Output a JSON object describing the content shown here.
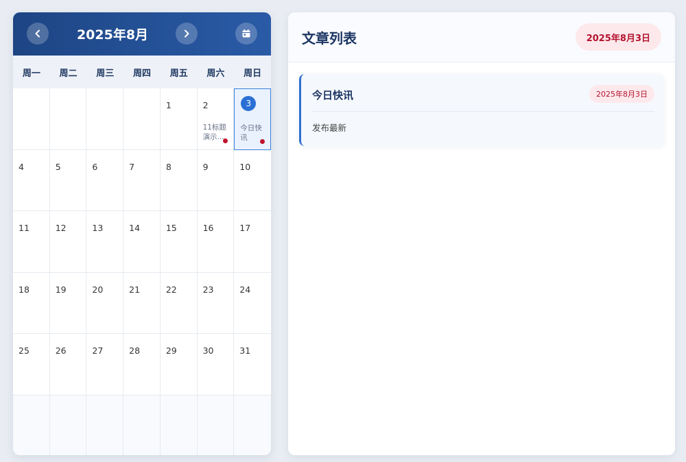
{
  "calendar": {
    "title": "2025年8月",
    "prev_icon": "chevron-left-icon",
    "next_icon": "chevron-right-icon",
    "today_icon": "calendar-icon",
    "weekdays": [
      "周一",
      "周二",
      "周三",
      "周四",
      "周五",
      "周六",
      "周日"
    ],
    "today": "3",
    "leading_blanks": 4,
    "days": [
      {
        "n": "1"
      },
      {
        "n": "2",
        "event": "11标题演示...",
        "has_event": true
      },
      {
        "n": "3",
        "event": "今日快讯",
        "has_event": true,
        "today": true
      },
      {
        "n": "4"
      },
      {
        "n": "5"
      },
      {
        "n": "6"
      },
      {
        "n": "7"
      },
      {
        "n": "8"
      },
      {
        "n": "9"
      },
      {
        "n": "10"
      },
      {
        "n": "11"
      },
      {
        "n": "12"
      },
      {
        "n": "13"
      },
      {
        "n": "14"
      },
      {
        "n": "15"
      },
      {
        "n": "16"
      },
      {
        "n": "17"
      },
      {
        "n": "18"
      },
      {
        "n": "19"
      },
      {
        "n": "20"
      },
      {
        "n": "21"
      },
      {
        "n": "22"
      },
      {
        "n": "23"
      },
      {
        "n": "24"
      },
      {
        "n": "25"
      },
      {
        "n": "26"
      },
      {
        "n": "27"
      },
      {
        "n": "28"
      },
      {
        "n": "29"
      },
      {
        "n": "30"
      },
      {
        "n": "31"
      }
    ],
    "colors": {
      "header": "#1d4584",
      "today": "#2a6fd6",
      "event_dot": "#c0142d"
    }
  },
  "panel": {
    "title": "文章列表",
    "selected_date": "2025年8月3日",
    "articles": [
      {
        "title": "今日快讯",
        "date": "2025年8月3日",
        "summary": "发布最新"
      }
    ]
  }
}
